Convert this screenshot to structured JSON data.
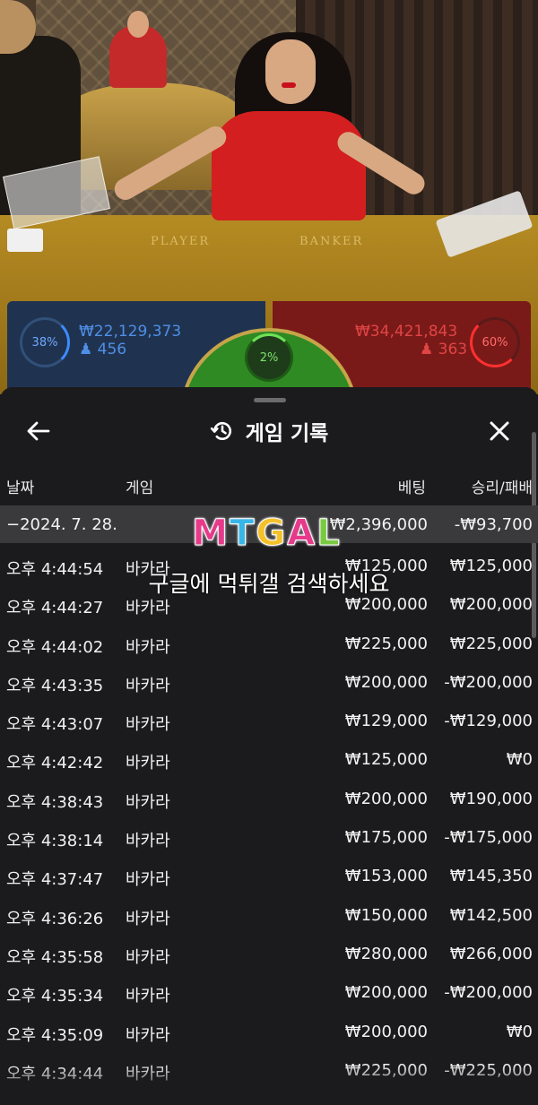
{
  "video": {
    "felt_player_label": "PLAYER",
    "felt_banker_label": "BANKER"
  },
  "betbar": {
    "player": {
      "percent": "38%",
      "amount": "₩22,129,373",
      "count": "456",
      "color": "#4f8fe6"
    },
    "tie": {
      "percent": "2%",
      "color": "#2f8a23"
    },
    "banker": {
      "percent": "60%",
      "amount": "₩34,421,843",
      "count": "363",
      "color": "#e04545"
    }
  },
  "sheet": {
    "back_icon": "arrow-left-icon",
    "history_icon": "history-clock-icon",
    "close_icon": "close-icon",
    "title": "게임 기록",
    "columns": {
      "date": "날짜",
      "game": "게임",
      "bet": "베팅",
      "win": "승리/패배"
    },
    "summary": {
      "date": "−2024. 7. 28.",
      "bet": "₩2,396,000",
      "win": "-₩93,700"
    },
    "rows": [
      {
        "date": "오후 4:44:54",
        "game": "바카라",
        "bet": "₩125,000",
        "win": "₩125,000"
      },
      {
        "date": "오후 4:44:27",
        "game": "바카라",
        "bet": "₩200,000",
        "win": "₩200,000"
      },
      {
        "date": "오후 4:44:02",
        "game": "바카라",
        "bet": "₩225,000",
        "win": "₩225,000"
      },
      {
        "date": "오후 4:43:35",
        "game": "바카라",
        "bet": "₩200,000",
        "win": "-₩200,000"
      },
      {
        "date": "오후 4:43:07",
        "game": "바카라",
        "bet": "₩129,000",
        "win": "-₩129,000"
      },
      {
        "date": "오후 4:42:42",
        "game": "바카라",
        "bet": "₩125,000",
        "win": "₩0"
      },
      {
        "date": "오후 4:38:43",
        "game": "바카라",
        "bet": "₩200,000",
        "win": "₩190,000"
      },
      {
        "date": "오후 4:38:14",
        "game": "바카라",
        "bet": "₩175,000",
        "win": "-₩175,000"
      },
      {
        "date": "오후 4:37:47",
        "game": "바카라",
        "bet": "₩153,000",
        "win": "₩145,350"
      },
      {
        "date": "오후 4:36:26",
        "game": "바카라",
        "bet": "₩150,000",
        "win": "₩142,500"
      },
      {
        "date": "오후 4:35:58",
        "game": "바카라",
        "bet": "₩280,000",
        "win": "₩266,000"
      },
      {
        "date": "오후 4:35:34",
        "game": "바카라",
        "bet": "₩200,000",
        "win": "-₩200,000"
      },
      {
        "date": "오후 4:35:09",
        "game": "바카라",
        "bet": "₩200,000",
        "win": "₩0"
      },
      {
        "date": "오후 4:34:44",
        "game": "바카라",
        "bet": "₩225,000",
        "win": "-₩225,000"
      }
    ]
  },
  "watermark": {
    "logo": "MTGAL",
    "logo_colors": [
      "#e63a8a",
      "#39b6e8",
      "#f4c12a",
      "#e63a8a",
      "#7ac943"
    ],
    "text": "구글에 먹튀갤 검색하세요"
  }
}
